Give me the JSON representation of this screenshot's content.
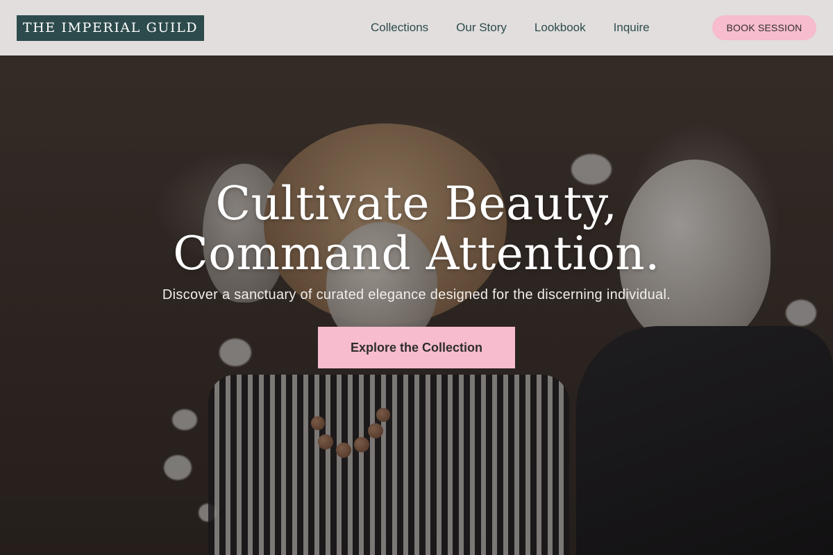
{
  "brand": {
    "logo_text": "THE IMPERIAL GUILD",
    "primary_color": "#2d4b4c",
    "accent_color": "#f7bccd"
  },
  "nav": {
    "items": [
      {
        "label": "Collections"
      },
      {
        "label": "Our Story"
      },
      {
        "label": "Lookbook"
      },
      {
        "label": "Inquire"
      }
    ],
    "cta_label": "BOOK SESSION"
  },
  "hero": {
    "headline_line1": "Cultivate Beauty,",
    "headline_line2": "Command Attention.",
    "subheadline": "Discover a sanctuary of curated elegance designed for the discerning individual.",
    "cta_label": "Explore the Collection",
    "background_image": "boutique-mannequins-photo"
  }
}
